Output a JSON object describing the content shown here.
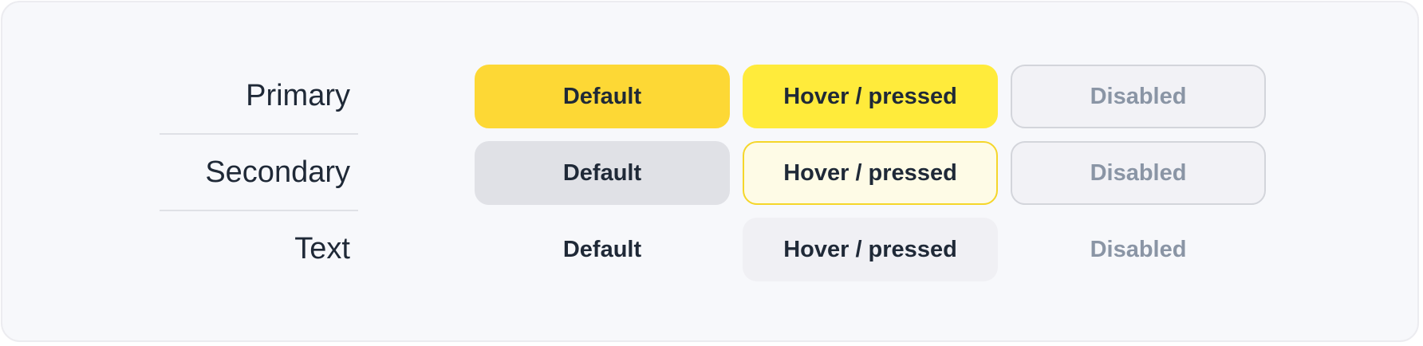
{
  "rows": [
    {
      "label": "Primary",
      "default_label": "Default",
      "hover_label": "Hover / pressed",
      "disabled_label": "Disabled"
    },
    {
      "label": "Secondary",
      "default_label": "Default",
      "hover_label": "Hover / pressed",
      "disabled_label": "Disabled"
    },
    {
      "label": "Text",
      "default_label": "Default",
      "hover_label": "Hover / pressed",
      "disabled_label": "Disabled"
    }
  ],
  "colors": {
    "primary_default": "#fdd835",
    "primary_hover": "#ffeb3b",
    "secondary_default": "#e0e1e6",
    "secondary_hover_bg": "#fefbe6",
    "secondary_hover_border": "#f5d62a",
    "text_hover_bg": "#f0f0f4",
    "disabled_bg": "#f2f2f6",
    "disabled_text": "#8a95a5",
    "label_text": "#1f2937"
  }
}
